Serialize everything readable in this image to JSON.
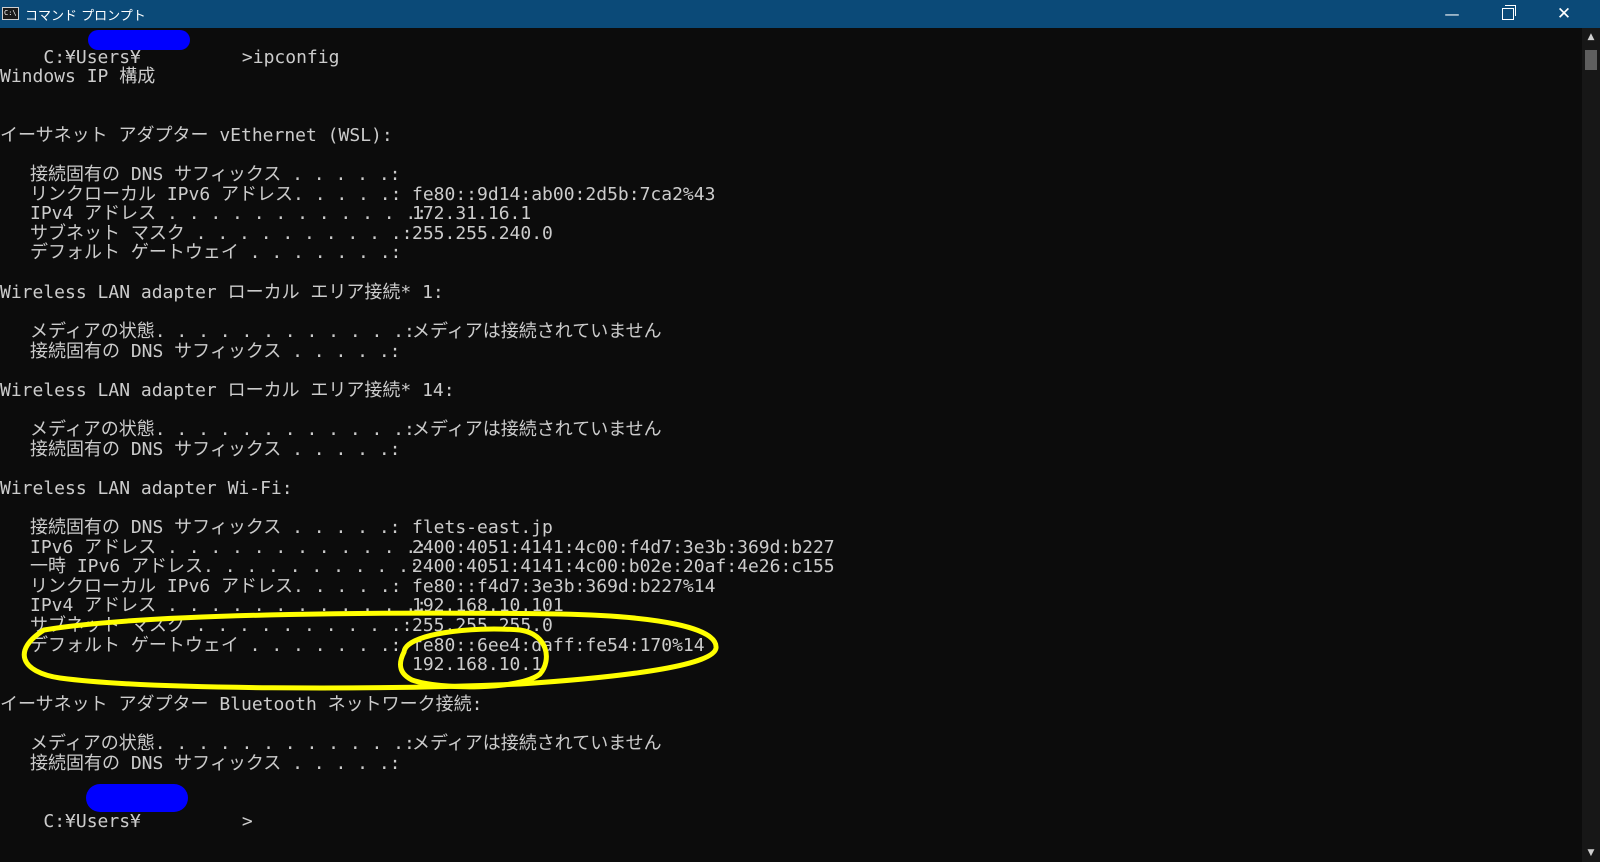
{
  "window": {
    "title": "コマンド プロンプト",
    "icon_text": "C:\\",
    "minimize": "—",
    "close": "✕"
  },
  "console": {
    "prompt1_prefix": "C:¥Users¥",
    "prompt1_suffix": ">ipconfig",
    "header": "Windows IP 構成",
    "sections": [
      {
        "title": "イーサネット アダプター vEthernet (WSL):",
        "rows": [
          {
            "label": "接続固有の DNS サフィックス",
            "dots": " . . . . .:",
            "value": ""
          },
          {
            "label": "リンクローカル IPv6 アドレス",
            "dots": ". . . . .:",
            "value": "fe80::9d14:ab00:2d5b:7ca2%43"
          },
          {
            "label": "IPv4 アドレス",
            "dots": " . . . . . . . . . . . .:",
            "value": "172.31.16.1"
          },
          {
            "label": "サブネット マスク",
            "dots": " . . . . . . . . . .:",
            "value": "255.255.240.0"
          },
          {
            "label": "デフォルト ゲートウェイ",
            "dots": " . . . . . . .:",
            "value": ""
          }
        ]
      },
      {
        "title": "Wireless LAN adapter ローカル エリア接続* 1:",
        "rows": [
          {
            "label": "メディアの状態",
            "dots": ". . . . . . . . . . . .:",
            "value": "メディアは接続されていません"
          },
          {
            "label": "接続固有の DNS サフィックス",
            "dots": " . . . . .:",
            "value": ""
          }
        ]
      },
      {
        "title": "Wireless LAN adapter ローカル エリア接続* 14:",
        "rows": [
          {
            "label": "メディアの状態",
            "dots": ". . . . . . . . . . . .:",
            "value": "メディアは接続されていません"
          },
          {
            "label": "接続固有の DNS サフィックス",
            "dots": " . . . . .:",
            "value": ""
          }
        ]
      },
      {
        "title": "Wireless LAN adapter Wi-Fi:",
        "rows": [
          {
            "label": "接続固有の DNS サフィックス",
            "dots": " . . . . .:",
            "value": "flets-east.jp"
          },
          {
            "label": "IPv6 アドレス",
            "dots": " . . . . . . . . . . . .:",
            "value": "2400:4051:4141:4c00:f4d7:3e3b:369d:b227"
          },
          {
            "label": "一時 IPv6 アドレス",
            "dots": ". . . . . . . . . .:",
            "value": "2400:4051:4141:4c00:b02e:20af:4e26:c155"
          },
          {
            "label": "リンクローカル IPv6 アドレス",
            "dots": ". . . . .:",
            "value": "fe80::f4d7:3e3b:369d:b227%14"
          },
          {
            "label": "IPv4 アドレス",
            "dots": " . . . . . . . . . . . .:",
            "value": "192.168.10.101"
          },
          {
            "label": "サブネット マスク",
            "dots": " . . . . . . . . . .:",
            "value": "255.255.255.0"
          },
          {
            "label": "デフォルト ゲートウェイ",
            "dots": " . . . . . . .:",
            "value": "fe80::6ee4:daff:fe54:170%14"
          },
          {
            "label": "",
            "dots": "",
            "value": "192.168.10.1"
          }
        ]
      },
      {
        "title": "イーサネット アダプター Bluetooth ネットワーク接続:",
        "rows": [
          {
            "label": "メディアの状態",
            "dots": ". . . . . . . . . . . .:",
            "value": "メディアは接続されていません"
          },
          {
            "label": "接続固有の DNS サフィックス",
            "dots": " . . . . .:",
            "value": ""
          }
        ]
      }
    ],
    "prompt2_prefix": "C:¥Users¥",
    "prompt2_suffix": ">"
  },
  "colors": {
    "titlebar": "#0b4a78",
    "console_bg": "#0c0c0c",
    "console_text": "#cccccc",
    "redaction": "#0000ff",
    "highlight": "#ffff00"
  },
  "scrollbar": {
    "up_icon": "▲",
    "down_icon": "▼"
  }
}
